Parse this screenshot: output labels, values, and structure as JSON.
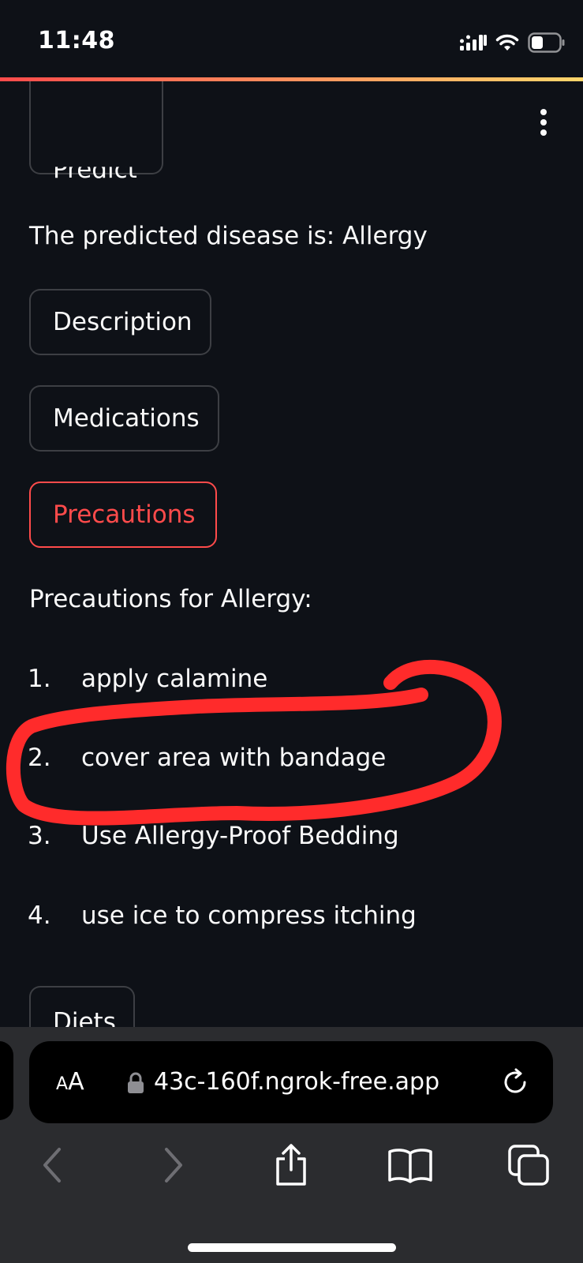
{
  "status_bar": {
    "time": "11:48"
  },
  "app": {
    "predict_button_label": "Predict",
    "prediction_text": "The predicted disease is: Allergy",
    "buttons": {
      "description": "Description",
      "medications": "Medications",
      "precautions": "Precautions",
      "diets": "Diets"
    },
    "precautions_heading": "Precautions for Allergy:",
    "precautions": [
      {
        "num": "1.",
        "label": "apply calamine"
      },
      {
        "num": "2.",
        "label": "cover area with bandage"
      },
      {
        "num": "3.",
        "label": "Use Allergy-Proof Bedding"
      },
      {
        "num": "4.",
        "label": "use ice to compress itching"
      }
    ],
    "active_button": "precautions"
  },
  "browser": {
    "text_size_label_big": "A",
    "text_size_label_small": "A",
    "url": "43c-160f.ngrok-free.app"
  },
  "colors": {
    "background": "#0e1117",
    "accent": "#ff4b4b",
    "annotation_stroke": "#ff2b2b",
    "browser_bar": "#2b2c2f"
  },
  "icons": [
    "signal-icon",
    "wifi-icon",
    "battery-icon",
    "kebab-menu-icon",
    "lock-icon",
    "reload-icon",
    "back-icon",
    "forward-icon",
    "share-icon",
    "bookmarks-icon",
    "tabs-icon"
  ]
}
